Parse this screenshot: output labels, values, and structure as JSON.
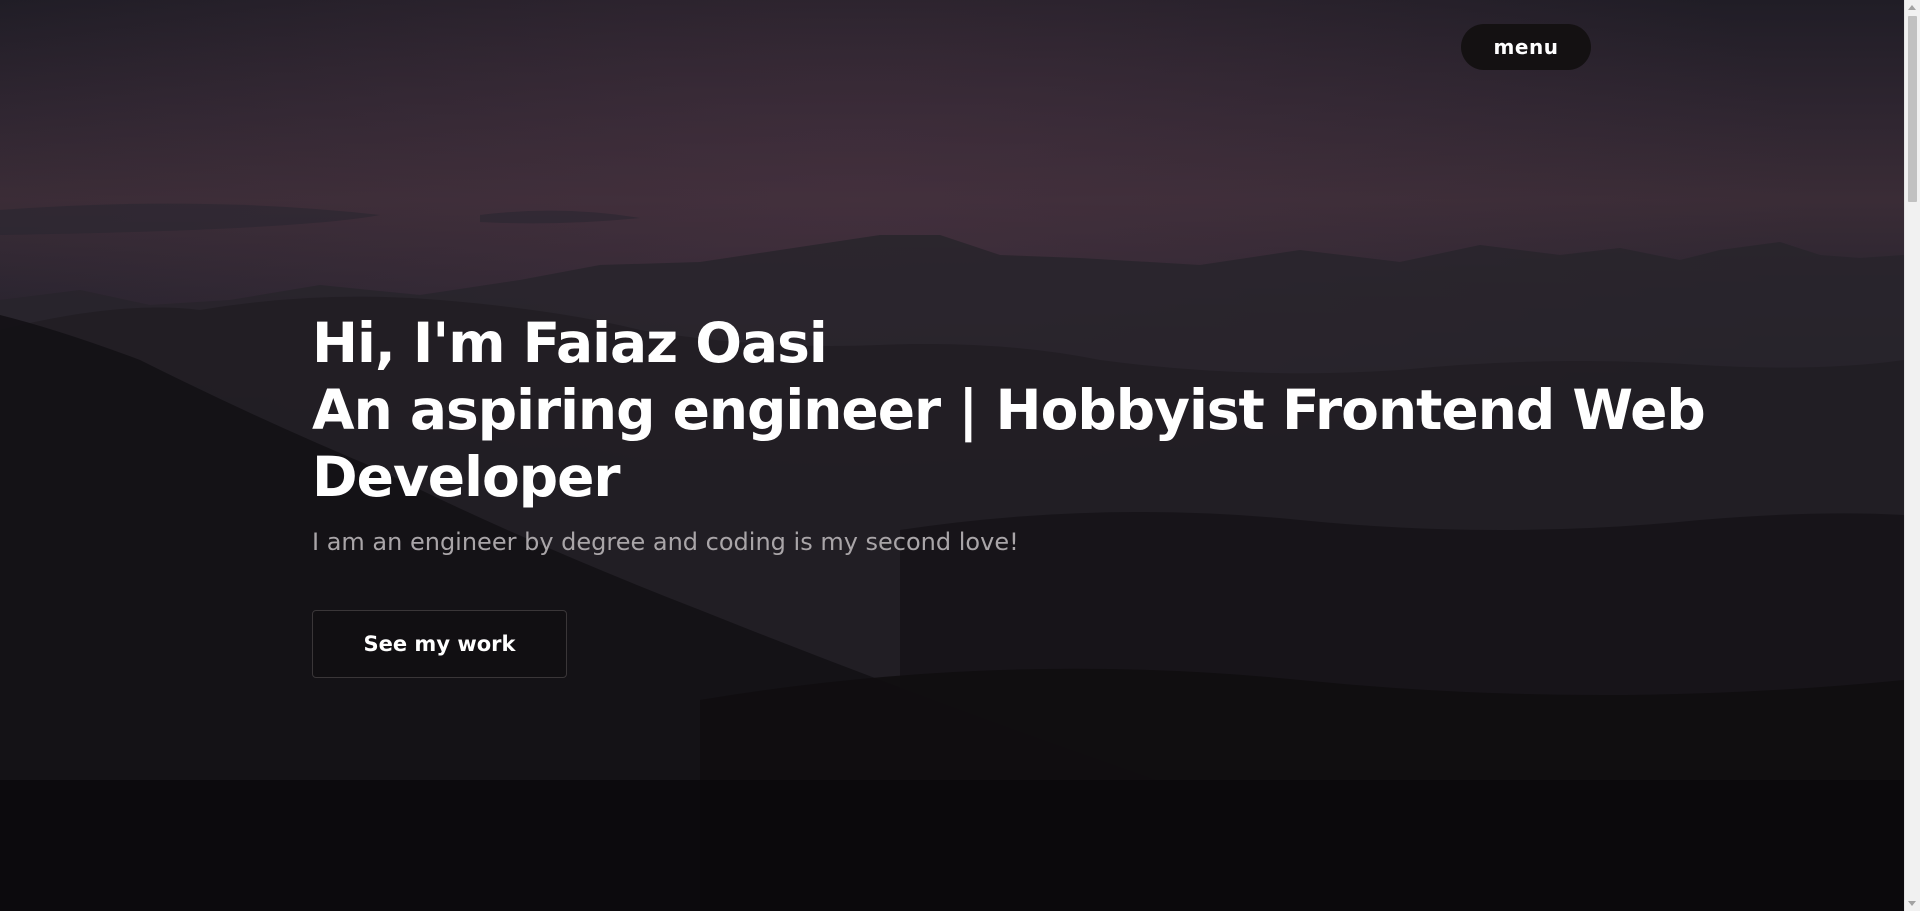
{
  "nav": {
    "menu_label": "menu"
  },
  "hero": {
    "title_line1": "Hi, I'm Faiaz Oasi",
    "title_line2": "An aspiring engineer | Hobbyist Frontend Web Developer",
    "subtitle": "I am an engineer by degree and coding is my second love!",
    "cta_label": "See my work"
  },
  "colors": {
    "background_top": "#352a35",
    "background_bottom": "#0b0a0c",
    "menu_button": "#141112",
    "subtitle_text": "#a9a5a8"
  },
  "scrollbar": {
    "position_fraction": 0.0
  }
}
